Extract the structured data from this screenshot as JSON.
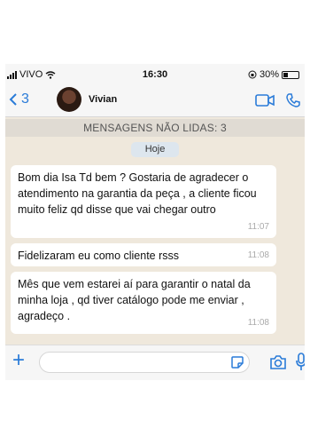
{
  "status_bar": {
    "carrier": "VIVO",
    "time": "16:30",
    "battery": "30%"
  },
  "header": {
    "back_count": "3",
    "contact_name": "Vivian"
  },
  "chat": {
    "unread_banner": "MENSAGENS NÃO LIDAS: 3",
    "date_chip": "Hoje",
    "messages": [
      {
        "text": "Bom dia Isa Td bem ? Gostaria de agradecer o atendimento na garantia da peça , a cliente ficou muito feliz qd disse que vai chegar outro",
        "time": "11:07"
      },
      {
        "text": "Fidelizaram eu como cliente rsss",
        "time": "11:08"
      },
      {
        "text": "Mês que vem estarei aí para garantir o natal da minha loja , qd tiver catálogo pode me enviar , agradeço .",
        "time": "11:08"
      }
    ]
  },
  "input": {
    "placeholder": ""
  },
  "colors": {
    "accent": "#2a7bd8",
    "chat_bg": "#efe8dc",
    "bubble": "#ffffff"
  },
  "icons": [
    "signal-icon",
    "wifi-icon",
    "battery-icon",
    "back-chevron-icon",
    "video-call-icon",
    "phone-icon",
    "plus-icon",
    "sticker-icon",
    "camera-icon",
    "microphone-icon"
  ]
}
